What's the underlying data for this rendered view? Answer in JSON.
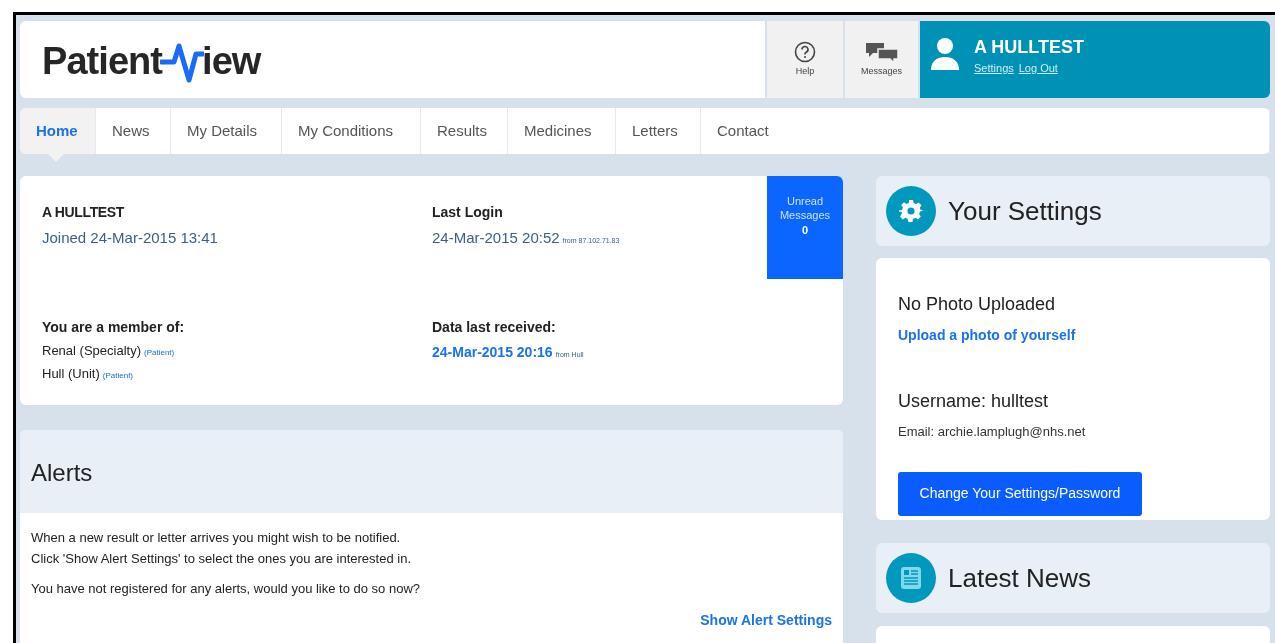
{
  "header": {
    "logo": {
      "before": "Patient",
      "after": "iew"
    },
    "help": {
      "label": "Help"
    },
    "messages": {
      "label": "Messages"
    },
    "user": {
      "name": "A HULLTEST",
      "links": [
        "Settings",
        "Log Out"
      ]
    }
  },
  "tabs": [
    {
      "label": "Home",
      "selected": true
    },
    {
      "label": "News",
      "selected": false
    },
    {
      "label": "My Details",
      "selected": false
    },
    {
      "label": "My Conditions",
      "selected": false
    },
    {
      "label": "Results",
      "selected": false
    },
    {
      "label": "Medicines",
      "selected": false
    },
    {
      "label": "Letters",
      "selected": false
    },
    {
      "label": "Contact",
      "selected": false
    }
  ],
  "profile": {
    "name": "A HULLTEST",
    "joined": "Joined 24-Mar-2015 13:41",
    "last_login": {
      "label": "Last Login",
      "date": "24-Mar-2015 20:52",
      "source": "from 87.102.71.83"
    },
    "membership": {
      "label": "You are a member of:",
      "items": [
        {
          "name": "Renal (Specialty)",
          "role": "(Patient)"
        },
        {
          "name": "Hull (Unit)",
          "role": "(Patient)"
        }
      ]
    },
    "data_received": {
      "label": "Data last received:",
      "date": "24-Mar-2015 20:16",
      "source": "from Hull"
    },
    "unread": {
      "label": "Unread Messages",
      "count": "0"
    }
  },
  "alerts": {
    "title": "Alerts",
    "paragraphs": [
      "When a new result or letter arrives you might wish to be notified.\nClick 'Show Alert Settings' to select the ones you are interested in.",
      "You have not registered for any alerts, would you like to do so now?"
    ],
    "link": "Show Alert Settings"
  },
  "settings": {
    "title": "Your Settings",
    "photo_status": "No Photo Uploaded",
    "upload_link": "Upload a photo of yourself",
    "username": "Username: hulltest",
    "email": "Email: archie.lamplugh@nhs.net",
    "button": "Change Your Settings/Password"
  },
  "news": {
    "title": "Latest News"
  }
}
